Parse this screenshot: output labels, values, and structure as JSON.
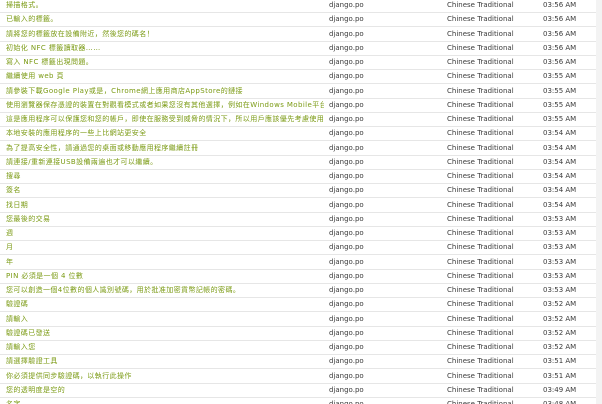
{
  "rows": [
    {
      "source": "掃描格式。",
      "file": "django.po",
      "language": "Chinese Traditional",
      "time": "03:56 AM"
    },
    {
      "source": "已輸入的標籤。",
      "file": "django.po",
      "language": "Chinese Traditional",
      "time": "03:56 AM"
    },
    {
      "source": "請將您的標籤放在設備附近，然後您的碼名！",
      "file": "django.po",
      "language": "Chinese Traditional",
      "time": "03:56 AM"
    },
    {
      "source": "初始化 NFC 標籤讀取器……",
      "file": "django.po",
      "language": "Chinese Traditional",
      "time": "03:56 AM"
    },
    {
      "source": "寫入 NFC 標籤出現問題。",
      "file": "django.po",
      "language": "Chinese Traditional",
      "time": "03:56 AM"
    },
    {
      "source": "繼續使用 web 頁",
      "file": "django.po",
      "language": "Chinese Traditional",
      "time": "03:55 AM"
    },
    {
      "source": "請參裝下載Google Play或是，Chrome網上應用商店AppStore的鏈接",
      "file": "django.po",
      "language": "Chinese Traditional",
      "time": "03:55 AM"
    },
    {
      "source": "使用瀏覽器保存憑證的裝置在對觀看模式或者如果您沒有其他選擇，例如在Windows Mobile平台上。",
      "file": "django.po",
      "language": "Chinese Traditional",
      "time": "03:55 AM"
    },
    {
      "source": "這是應用程序可以保護您和您的帳戶，即使在服務受到威脅的情況下，所以用戶應該優先考慮使用此選擇。",
      "file": "django.po",
      "language": "Chinese Traditional",
      "time": "03:55 AM"
    },
    {
      "source": "本地安裝的應用程序的一些上比網站更安全",
      "file": "django.po",
      "language": "Chinese Traditional",
      "time": "03:54 AM"
    },
    {
      "source": "為了提高安全性，請通過您的桌面或移動應用程序繼續註冊",
      "file": "django.po",
      "language": "Chinese Traditional",
      "time": "03:54 AM"
    },
    {
      "source": "請連接/重新連接USB設備兩遍也才可以繼續。",
      "file": "django.po",
      "language": "Chinese Traditional",
      "time": "03:54 AM"
    },
    {
      "source": "搜尋",
      "file": "django.po",
      "language": "Chinese Traditional",
      "time": "03:54 AM"
    },
    {
      "source": "簽名",
      "file": "django.po",
      "language": "Chinese Traditional",
      "time": "03:54 AM"
    },
    {
      "source": "找日期",
      "file": "django.po",
      "language": "Chinese Traditional",
      "time": "03:54 AM"
    },
    {
      "source": "您最後的交易",
      "file": "django.po",
      "language": "Chinese Traditional",
      "time": "03:53 AM"
    },
    {
      "source": "週",
      "file": "django.po",
      "language": "Chinese Traditional",
      "time": "03:53 AM"
    },
    {
      "source": "月",
      "file": "django.po",
      "language": "Chinese Traditional",
      "time": "03:53 AM"
    },
    {
      "source": "年",
      "file": "django.po",
      "language": "Chinese Traditional",
      "time": "03:53 AM"
    },
    {
      "source": "PIN 必須是一個 4 位數",
      "file": "django.po",
      "language": "Chinese Traditional",
      "time": "03:53 AM"
    },
    {
      "source": "您可以創造一個4位數的個人識別號碼，用於批准加密貨幣記帳的密碼。",
      "file": "django.po",
      "language": "Chinese Traditional",
      "time": "03:53 AM"
    },
    {
      "source": "驗證碼",
      "file": "django.po",
      "language": "Chinese Traditional",
      "time": "03:52 AM"
    },
    {
      "source": "請輸入",
      "file": "django.po",
      "language": "Chinese Traditional",
      "time": "03:52 AM"
    },
    {
      "source": "驗證碼已發送",
      "file": "django.po",
      "language": "Chinese Traditional",
      "time": "03:52 AM"
    },
    {
      "source": "請輸入您",
      "file": "django.po",
      "language": "Chinese Traditional",
      "time": "03:52 AM"
    },
    {
      "source": "請選擇驗證工具",
      "file": "django.po",
      "language": "Chinese Traditional",
      "time": "03:51 AM"
    },
    {
      "source": "你必須提供同步驗證碼，以執行此操作",
      "file": "django.po",
      "language": "Chinese Traditional",
      "time": "03:51 AM"
    },
    {
      "source": "您的透明度是空的",
      "file": "django.po",
      "language": "Chinese Traditional",
      "time": "03:49 AM"
    },
    {
      "source": "名字",
      "file": "django.po",
      "language": "Chinese Traditional",
      "time": "03:48 AM"
    }
  ]
}
